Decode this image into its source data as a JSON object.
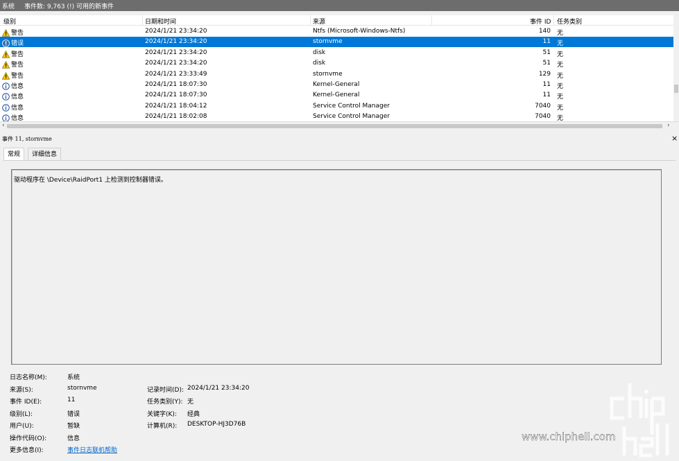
{
  "titlebar": {
    "title": "系统",
    "count_text": "事件数: 9,763 (!) 可用的新事件"
  },
  "columns": {
    "level": "级别",
    "datetime": "日期和时间",
    "source": "来源",
    "event_id": "事件 ID",
    "task": "任务类别"
  },
  "rows": [
    {
      "level": "警告",
      "icon": "warning-icon",
      "datetime": "2024/1/21 23:34:20",
      "source": "Ntfs (Microsoft-Windows-Ntfs)",
      "id": "140",
      "task": "无"
    },
    {
      "level": "错误",
      "icon": "error-icon",
      "datetime": "2024/1/21 23:34:20",
      "source": "stornvme",
      "id": "11",
      "task": "无"
    },
    {
      "level": "警告",
      "icon": "warning-icon",
      "datetime": "2024/1/21 23:34:20",
      "source": "disk",
      "id": "51",
      "task": "无"
    },
    {
      "level": "警告",
      "icon": "warning-icon",
      "datetime": "2024/1/21 23:34:20",
      "source": "disk",
      "id": "51",
      "task": "无"
    },
    {
      "level": "警告",
      "icon": "warning-icon",
      "datetime": "2024/1/21 23:33:49",
      "source": "stornvme",
      "id": "129",
      "task": "无"
    },
    {
      "level": "信息",
      "icon": "info-icon",
      "datetime": "2024/1/21 18:07:30",
      "source": "Kernel-General",
      "id": "11",
      "task": "无"
    },
    {
      "level": "信息",
      "icon": "info-icon",
      "datetime": "2024/1/21 18:07:30",
      "source": "Kernel-General",
      "id": "11",
      "task": "无"
    },
    {
      "level": "信息",
      "icon": "info-icon",
      "datetime": "2024/1/21 18:04:12",
      "source": "Service Control Manager",
      "id": "7040",
      "task": "无"
    },
    {
      "level": "信息",
      "icon": "info-icon",
      "datetime": "2024/1/21 18:02:08",
      "source": "Service Control Manager",
      "id": "7040",
      "task": "无"
    }
  ],
  "detail": {
    "header": "事件 11, stornvme",
    "close": "×",
    "tabs": {
      "general": "常规",
      "details": "详细信息"
    },
    "description": "驱动程序在 \\Device\\RaidPort1 上检测到控制器错误。",
    "labels": {
      "log_name": "日志名称(M):",
      "source": "来源(S):",
      "event_id": "事件 ID(E):",
      "level": "级别(L):",
      "user": "用户(U):",
      "opcode": "操作代码(O):",
      "more_info": "更多信息(I):",
      "logged": "记录时间(D):",
      "task": "任务类别(Y):",
      "keywords": "关键字(K):",
      "computer": "计算机(R):"
    },
    "values": {
      "log_name": "系统",
      "source": "stornvme",
      "event_id": "11",
      "level": "错误",
      "user": "暂缺",
      "opcode": "信息",
      "more_info": "事件日志联机帮助",
      "logged": "2024/1/21 23:34:20",
      "task": "无",
      "keywords": "经典",
      "computer": "DESKTOP-HJ3D76B"
    }
  },
  "watermark": {
    "text": "www.chiphell.com"
  },
  "colors": {
    "selection": "#0078d7",
    "warning": "#f5c400",
    "info": "#1f4e9c",
    "link": "#0066cc"
  }
}
